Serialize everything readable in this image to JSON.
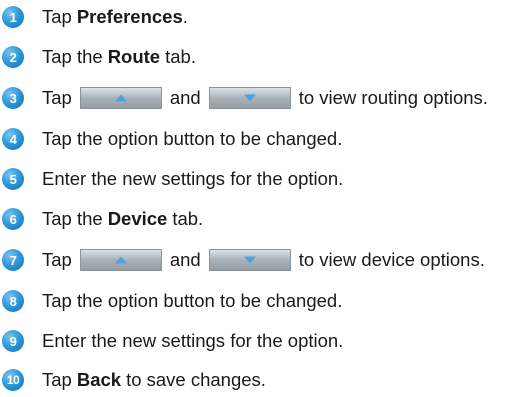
{
  "steps": [
    {
      "num": "1",
      "before": "Tap",
      "bold": "Preferences",
      "after": "."
    },
    {
      "num": "2",
      "before": "Tap the",
      "bold": "Route",
      "after": "tab."
    },
    {
      "num": "3",
      "before": "Tap",
      "mid": "and",
      "after": "to view routing options."
    },
    {
      "num": "4",
      "text": "Tap the option button to be changed."
    },
    {
      "num": "5",
      "text": "Enter the new settings for the option."
    },
    {
      "num": "6",
      "before": "Tap the",
      "bold": "Device",
      "after": "tab."
    },
    {
      "num": "7",
      "before": "Tap",
      "mid": "and",
      "after": "to view device options."
    },
    {
      "num": "8",
      "text": "Tap the option button to be changed."
    },
    {
      "num": "9",
      "text": "Enter the new settings for the option."
    },
    {
      "num": "10",
      "before": "Tap",
      "bold": "Back",
      "after": "to save changes."
    }
  ],
  "icons": {
    "up": "triangle-up-icon",
    "down": "triangle-down-icon"
  },
  "colors": {
    "badge": "#2f9ad9",
    "button_face": "#aab2b9",
    "arrow": "#4aa3df"
  }
}
